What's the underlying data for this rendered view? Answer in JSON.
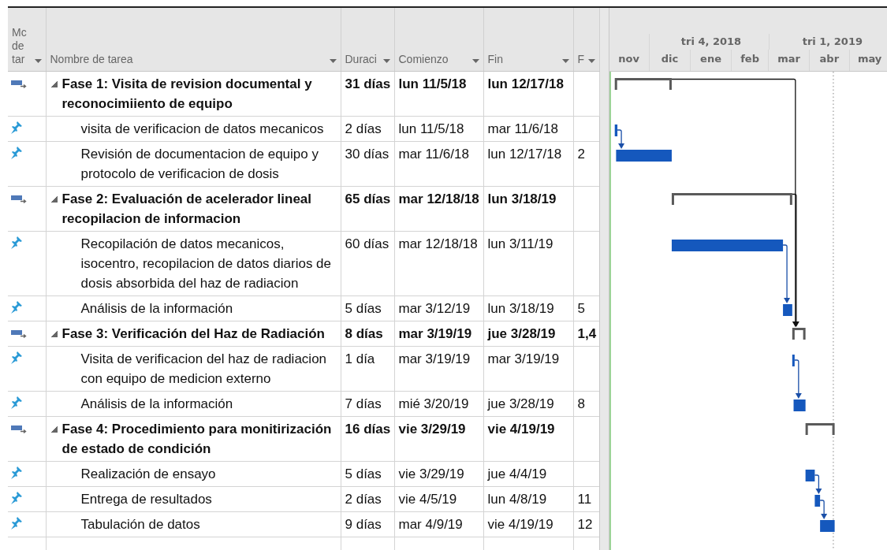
{
  "columns": [
    "Mc de tar",
    "Nombre de tarea",
    "Duraci",
    "Comienzo",
    "Fin",
    "F"
  ],
  "timescale": {
    "upper": [
      "tri 4, 2018",
      "tri 1, 2019"
    ],
    "lower": [
      "nov",
      "dic",
      "ene",
      "feb",
      "mar",
      "abr",
      "may"
    ]
  },
  "tasks": [
    {
      "kind": "summary",
      "name": "Fase 1: Visita de revision documental y reconocimiiento de equipo",
      "expanded": true,
      "duration": "31 días",
      "start": "lun 11/5/18",
      "finish": "lun 12/17/18",
      "children": [
        {
          "kind": "task",
          "name": "visita de verificacion de datos mecanicos",
          "duration": "2 días",
          "start": "lun 11/5/18",
          "finish": "mar 11/6/18"
        },
        {
          "kind": "task",
          "name": "Revisión de documentacion de equipo y protocolo de verificacion de dosis",
          "duration": "30 días",
          "start": "mar 11/6/18",
          "finish": "lun 12/17/18",
          "predecessors": "2"
        }
      ]
    },
    {
      "kind": "summary",
      "name": "Fase 2: Evaluación de acelerador lineal recopilacion de informacion",
      "expanded": true,
      "duration": "65 días",
      "start": "mar 12/18/18",
      "finish": "lun 3/18/19",
      "children": [
        {
          "kind": "task",
          "name": "Recopilación de datos mecanicos, isocentro, recopilacion de datos diarios de dosis absorbida del haz de radiacion",
          "duration": "60 días",
          "start": "mar 12/18/18",
          "finish": "lun 3/11/19"
        },
        {
          "kind": "task",
          "name": "Análisis de la información",
          "duration": "5 días",
          "start": "mar 3/12/19",
          "finish": "lun 3/18/19",
          "predecessors": "5"
        }
      ]
    },
    {
      "kind": "summary",
      "name": "Fase 3: Verificación del Haz de Radiación",
      "expanded": true,
      "duration": "8 días",
      "start": "mar 3/19/19",
      "finish": "jue 3/28/19",
      "predecessors": "1,4",
      "children": [
        {
          "kind": "task",
          "name": "Visita de verificacion del haz de radiacion con equipo de medicion externo",
          "duration": "1 día",
          "start": "mar 3/19/19",
          "finish": "mar 3/19/19"
        },
        {
          "kind": "task",
          "name": "Análisis de la información",
          "duration": "7 días",
          "start": "mié 3/20/19",
          "finish": "jue 3/28/19",
          "predecessors": "8"
        }
      ]
    },
    {
      "kind": "summary",
      "name": "Fase 4: Procedimiento para monitirización de estado de condición",
      "expanded": true,
      "duration": "16 días",
      "start": "vie 3/29/19",
      "finish": "vie 4/19/19",
      "children": [
        {
          "kind": "task",
          "name": "Realización de ensayo",
          "duration": "5 días",
          "start": "vie 3/29/19",
          "finish": "jue 4/4/19"
        },
        {
          "kind": "task",
          "name": "Entrega de resultados",
          "duration": "2 días",
          "start": "vie 4/5/19",
          "finish": "lun 4/8/19",
          "predecessors": "11"
        },
        {
          "kind": "task",
          "name": "Tabulación de datos",
          "duration": "9 días",
          "start": "mar 4/9/19",
          "finish": "vie 4/19/19",
          "predecessors": "12"
        }
      ]
    }
  ]
}
